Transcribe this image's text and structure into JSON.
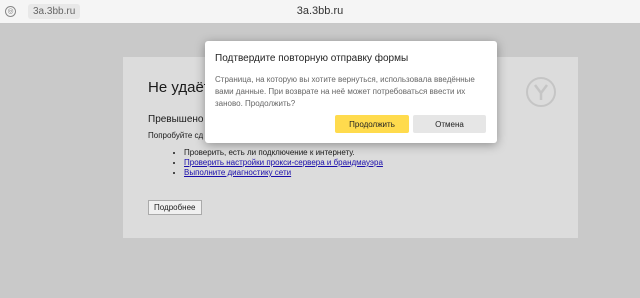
{
  "topbar": {
    "site_icon": "globe-icon",
    "url": "3a.3bb.ru",
    "title": "3a.3bb.ru"
  },
  "error_page": {
    "title": "Не удаёт",
    "subtitle": "Превышено",
    "hint": "Попробуйте сд",
    "items": [
      "Проверить, есть ли подключение к интернету.",
      "Проверить настройки прокси-сервера и брандмауэра",
      "Выполните диагностику сети"
    ],
    "details_button": "Подробнее",
    "logo": "yandex-browser-logo-icon"
  },
  "dialog": {
    "title": "Подтвердите повторную отправку формы",
    "message": "Страница, на которую вы хотите вернуться, использовала введённые вами данные. При возврате на неё может потребоваться ввести их заново. Продолжить?",
    "continue_button": "Продолжить",
    "cancel_button": "Отмена"
  },
  "colors": {
    "accent": "#ffdb4d",
    "link": "#1a0dab"
  }
}
